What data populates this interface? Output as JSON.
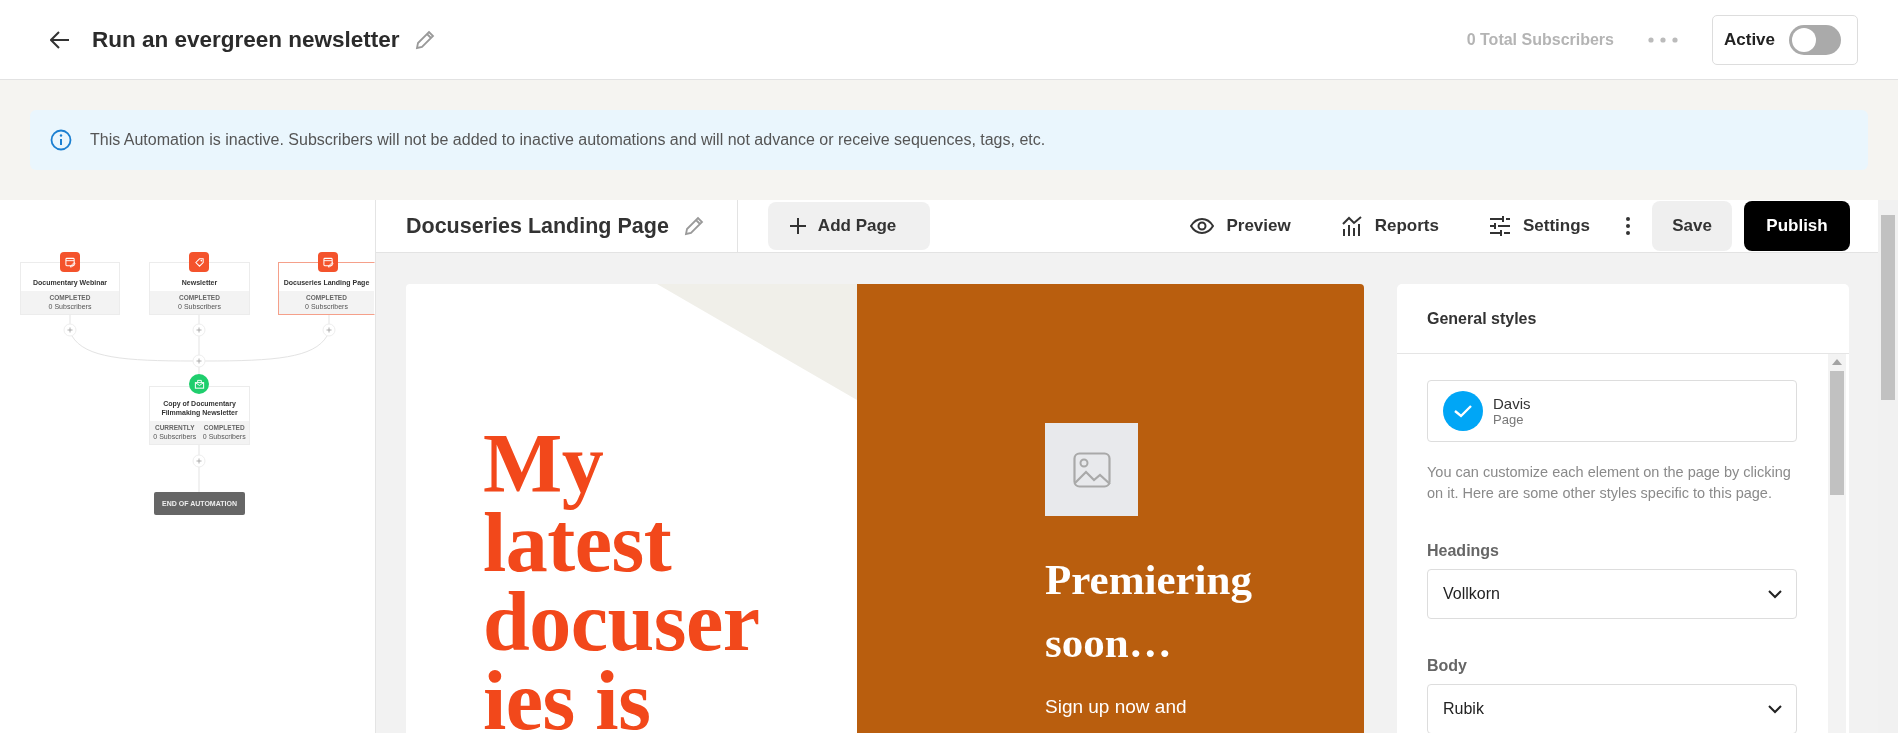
{
  "header": {
    "title": "Run an evergreen newsletter",
    "subscribers": "0 Total Subscribers",
    "toggle": {
      "label": "Active",
      "on": false
    }
  },
  "banner": {
    "text": "This Automation is inactive. Subscribers will not be added to inactive automations and will not advance or receive sequences, tags, etc."
  },
  "flow": {
    "nodes": [
      {
        "title": "Documentary Webinar",
        "kind": "page",
        "color": "#f4532c",
        "selected": false,
        "stats": [
          {
            "label": "COMPLETED",
            "value": "0 Subscribers"
          }
        ]
      },
      {
        "title": "Newsletter",
        "kind": "tag",
        "color": "#f4532c",
        "selected": false,
        "stats": [
          {
            "label": "COMPLETED",
            "value": "0 Subscribers"
          }
        ]
      },
      {
        "title": "Docuseries Landing Page",
        "kind": "page",
        "color": "#f4532c",
        "selected": true,
        "stats": [
          {
            "label": "COMPLETED",
            "value": "0 Subscribers"
          }
        ]
      },
      {
        "title": "Copy of Documentary Filmmaking Newsletter",
        "kind": "email",
        "color": "#1fce6d",
        "selected": false,
        "stats": [
          {
            "label": "CURRENTLY",
            "value": "0 Subscribers"
          },
          {
            "label": "COMPLETED",
            "value": "0 Subscribers"
          }
        ]
      }
    ],
    "end_label": "END OF AUTOMATION"
  },
  "toolbar": {
    "page_title": "Docuseries Landing Page",
    "add_page": "Add Page",
    "actions": [
      {
        "label": "Preview",
        "kind": "preview"
      },
      {
        "label": "Reports",
        "kind": "reports"
      },
      {
        "label": "Settings",
        "kind": "settings"
      }
    ],
    "save": "Save",
    "publish": "Publish"
  },
  "preview": {
    "headline_lines": [
      "My",
      "latest",
      "docuser",
      "ies is"
    ],
    "side_heading_lines": [
      "Premiering",
      "soon…"
    ],
    "side_text": "Sign up now and"
  },
  "panel": {
    "title": "General styles",
    "selected": {
      "name": "Davis",
      "type": "Page"
    },
    "description": "You can customize each element on the page by clicking on it. Here are some other styles specific to this page.",
    "fields": [
      {
        "label": "Headings",
        "value": "Vollkorn"
      },
      {
        "label": "Body",
        "value": "Rubik"
      }
    ]
  }
}
